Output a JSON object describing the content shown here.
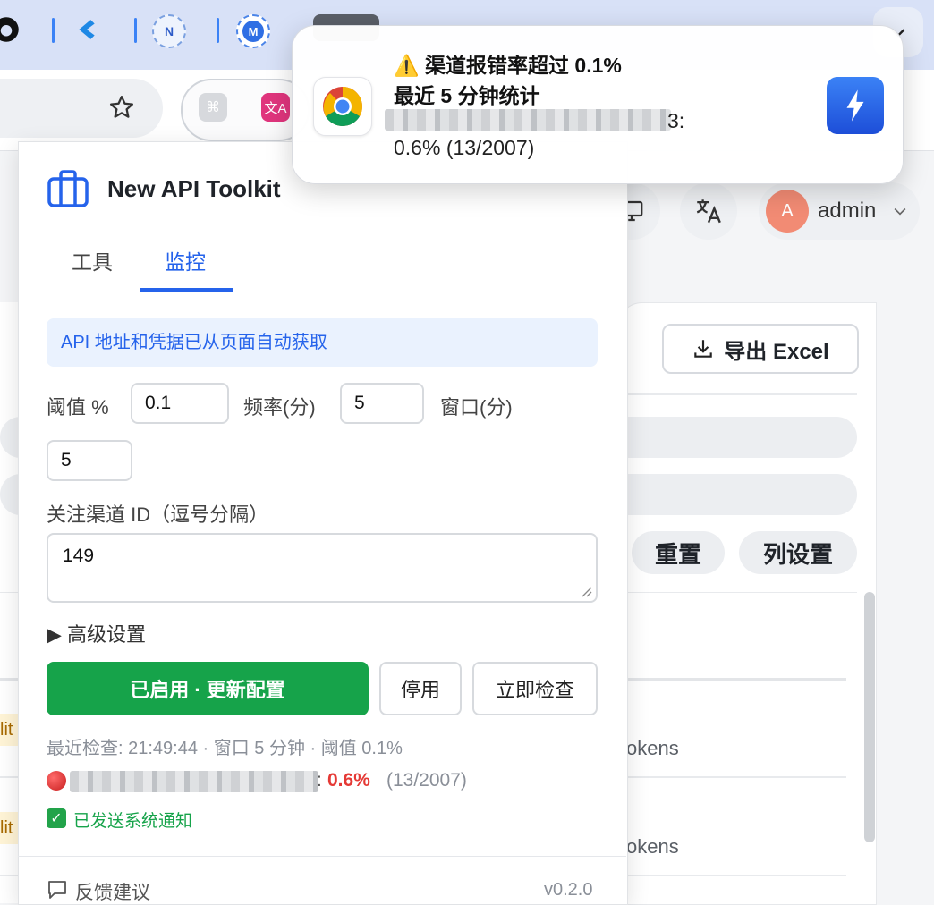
{
  "browser": {
    "colors": {
      "tabstrip": "#d8e1f7",
      "toolbar": "#ffffff"
    },
    "tab_icons": [
      {
        "name": "github-icon"
      },
      {
        "name": "kimi-icon"
      },
      {
        "name": "n-logo-icon"
      },
      {
        "name": "m-logo-icon"
      }
    ]
  },
  "page": {
    "export_label": "导出 Excel",
    "reset_label": "重置",
    "column_settings_label": "列设置",
    "user_avatar_letter": "A",
    "user_name": "admin",
    "row_fragment": "okens",
    "left_fragment": "lit"
  },
  "popup": {
    "title": "New API Toolkit",
    "tabs": [
      {
        "label": "工具",
        "active": false
      },
      {
        "label": "监控",
        "active": true
      }
    ],
    "info": "API 地址和凭据已从页面自动获取",
    "threshold_label": "阈值 %",
    "threshold_value": "0.1",
    "frequency_label": "频率(分)",
    "frequency_value": "5",
    "window_label": "窗口(分)",
    "window_value": "5",
    "channels_label": "关注渠道 ID（逗号分隔）",
    "channels_value": "149",
    "advanced_label": "▶ 高级设置",
    "enable_button": "已启用 · 更新配置",
    "disable_button": "停用",
    "check_button": "立即检查",
    "status": "最近检查: 21:49:44 · 窗口 5 分钟 · 阈值 0.1%",
    "alert": {
      "percent": "0.6%",
      "counts": "(13/2007)",
      "colon": ":"
    },
    "notified": "已发送系统通知",
    "feedback": "反馈建议",
    "version": "v0.2.0",
    "colors": {
      "primary": "#2563eb",
      "success": "#16a34a",
      "danger": "#e53935"
    }
  },
  "notification": {
    "title": "⚠️ 渠道报错率超过 0.1%",
    "subtitle": "最近 5 分钟统计",
    "body_tail": "3:",
    "body_line2": "0.6% (13/2007)"
  }
}
